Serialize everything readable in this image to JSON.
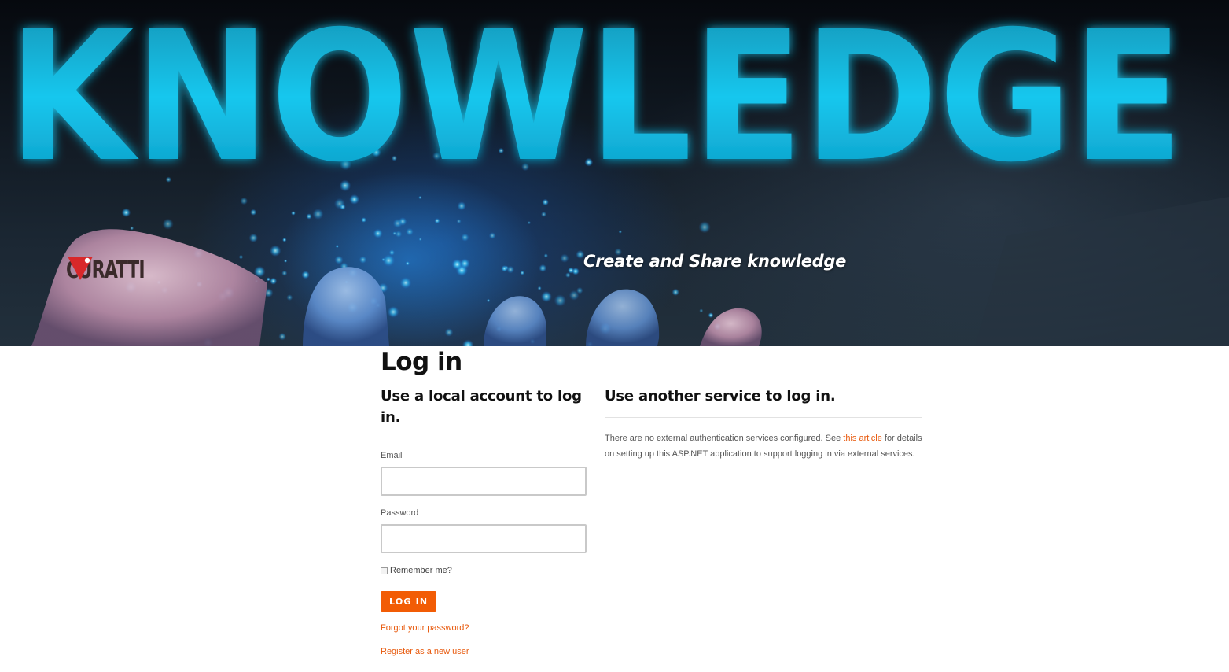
{
  "hero": {
    "headline": "KNOWLEDGE",
    "tagline": "Create and Share knowledge",
    "logo_text": "CURATTI"
  },
  "page": {
    "title": "Log in"
  },
  "local_login": {
    "heading": "Use a local account to log in.",
    "email_label": "Email",
    "email_value": "",
    "password_label": "Password",
    "password_value": "",
    "remember_label": "Remember me?",
    "remember_checked": false,
    "login_button": "LOG IN",
    "forgot_link": "Forgot your password?",
    "register_link": "Register as a new user"
  },
  "external_login": {
    "heading": "Use another service to log in.",
    "text_before": "There are no external authentication services configured. See ",
    "link_text": "this article",
    "text_after": " for details on setting up this ASP.NET application to support logging in via external services."
  },
  "colors": {
    "accent": "#f25c05",
    "link": "#e8590c",
    "glow": "#14c6ec"
  }
}
